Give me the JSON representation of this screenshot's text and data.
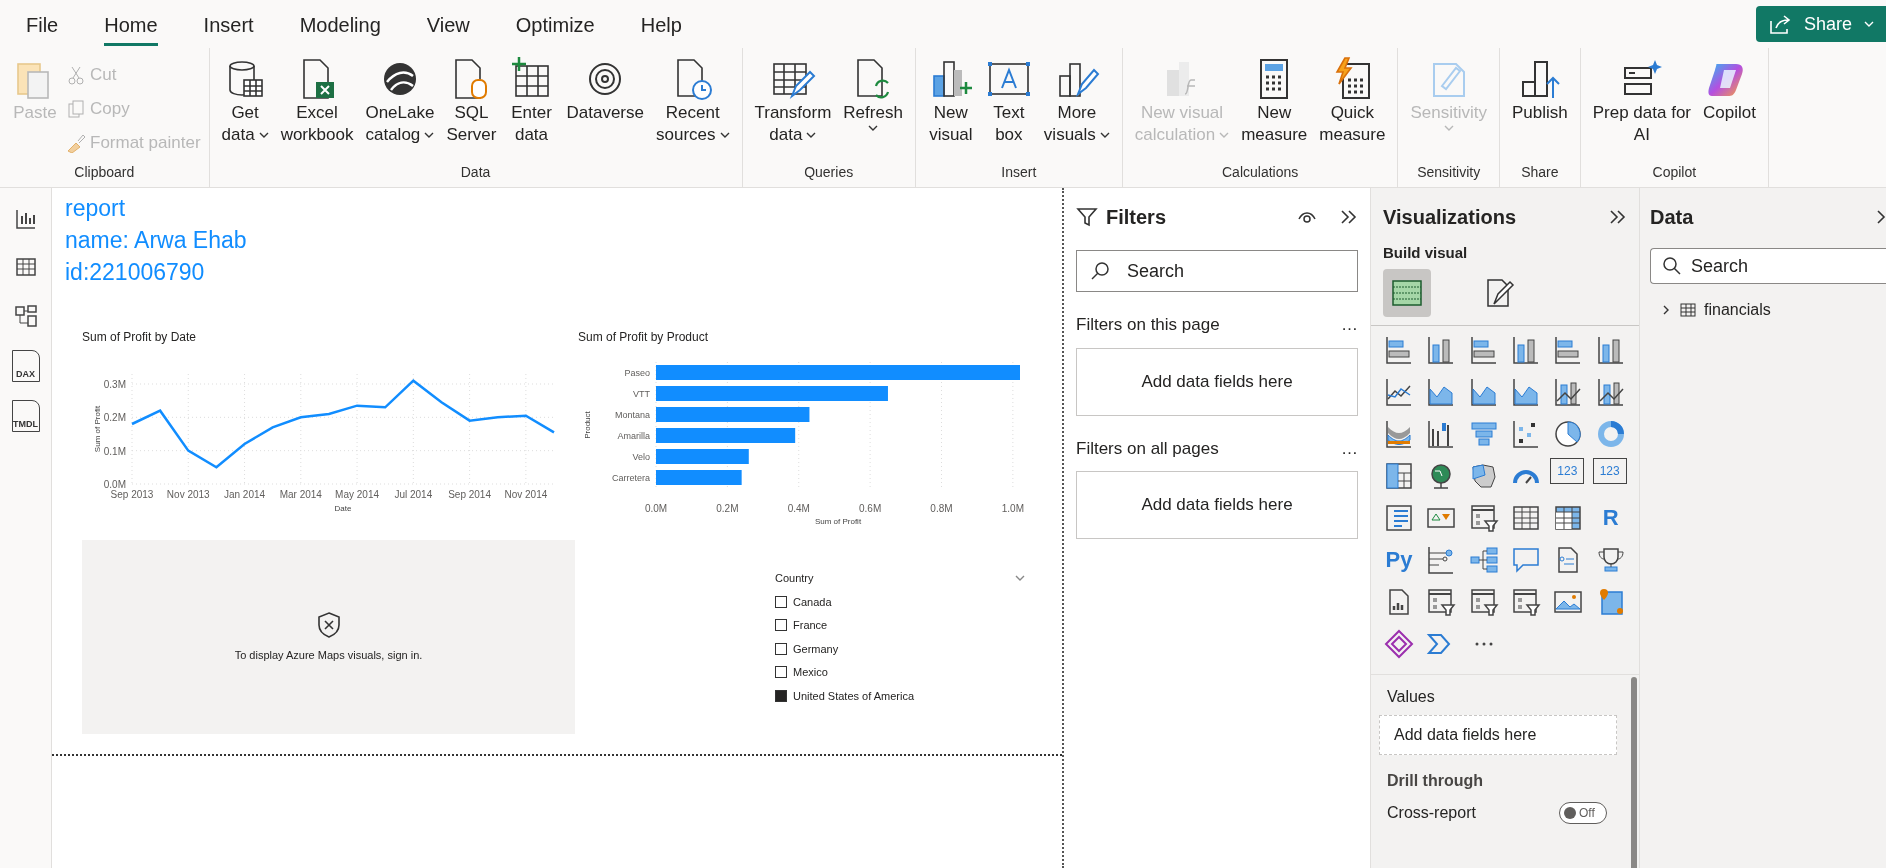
{
  "menu": {
    "tabs": [
      {
        "label": "File",
        "selected": false
      },
      {
        "label": "Home",
        "selected": true
      },
      {
        "label": "Insert",
        "selected": false
      },
      {
        "label": "Modeling",
        "selected": false
      },
      {
        "label": "View",
        "selected": false
      },
      {
        "label": "Optimize",
        "selected": false
      },
      {
        "label": "Help",
        "selected": false
      }
    ],
    "share_button": "Share"
  },
  "ribbon": [
    {
      "label": "Clipboard",
      "buttons": [
        {
          "kind": "paste",
          "lines": [
            "Paste"
          ],
          "dropdown": false,
          "disabled": true
        }
      ],
      "small_buttons": [
        {
          "kind": "cut",
          "label": "Cut",
          "disabled": true
        },
        {
          "kind": "copy",
          "label": "Copy",
          "disabled": true
        },
        {
          "kind": "brush",
          "label": "Format painter",
          "disabled": true
        }
      ]
    },
    {
      "label": "Data",
      "buttons": [
        {
          "kind": "database",
          "lines": [
            "Get",
            "data"
          ],
          "dropdown": true,
          "disabled": false
        },
        {
          "kind": "excel",
          "lines": [
            "Excel",
            "workbook"
          ],
          "dropdown": false,
          "disabled": false
        },
        {
          "kind": "onelake",
          "lines": [
            "OneLake",
            "catalog"
          ],
          "dropdown": true,
          "disabled": false
        },
        {
          "kind": "sql",
          "lines": [
            "SQL",
            "Server"
          ],
          "dropdown": false,
          "disabled": false
        },
        {
          "kind": "enter",
          "lines": [
            "Enter",
            "data"
          ],
          "dropdown": false,
          "disabled": false
        },
        {
          "kind": "dataverse",
          "lines": [
            "Dataverse"
          ],
          "dropdown": false,
          "disabled": false
        },
        {
          "kind": "recent",
          "lines": [
            "Recent",
            "sources"
          ],
          "dropdown": true,
          "disabled": false
        }
      ]
    },
    {
      "label": "Queries",
      "buttons": [
        {
          "kind": "transform",
          "lines": [
            "Transform",
            "data"
          ],
          "dropdown": true,
          "disabled": false
        },
        {
          "kind": "refresh",
          "lines": [
            "Refresh"
          ],
          "dropdown": true,
          "disabled": false
        }
      ]
    },
    {
      "label": "Insert",
      "buttons": [
        {
          "kind": "newvisual",
          "lines": [
            "New",
            "visual"
          ],
          "dropdown": false,
          "disabled": false
        },
        {
          "kind": "textbox",
          "lines": [
            "Text",
            "box"
          ],
          "dropdown": false,
          "disabled": false
        },
        {
          "kind": "morevisuals",
          "lines": [
            "More",
            "visuals"
          ],
          "dropdown": true,
          "disabled": false
        }
      ]
    },
    {
      "label": "Calculations",
      "buttons": [
        {
          "kind": "visualcalc",
          "lines": [
            "New visual",
            "calculation"
          ],
          "dropdown": true,
          "disabled": true
        },
        {
          "kind": "calculator",
          "lines": [
            "New",
            "measure"
          ],
          "dropdown": false,
          "disabled": false
        },
        {
          "kind": "quick",
          "lines": [
            "Quick",
            "measure"
          ],
          "dropdown": false,
          "disabled": false
        }
      ]
    },
    {
      "label": "Sensitivity",
      "buttons": [
        {
          "kind": "sensitivity",
          "lines": [
            "Sensitivity"
          ],
          "dropdown": true,
          "disabled": true
        }
      ]
    },
    {
      "label": "Share",
      "buttons": [
        {
          "kind": "publish",
          "lines": [
            "Publish"
          ],
          "dropdown": false,
          "disabled": false
        }
      ]
    },
    {
      "label": "Copilot",
      "buttons": [
        {
          "kind": "prep",
          "lines": [
            "Prep data for",
            "AI"
          ],
          "dropdown": false,
          "disabled": false
        },
        {
          "kind": "copilot",
          "lines": [
            "Copilot"
          ],
          "dropdown": false,
          "disabled": false
        }
      ]
    }
  ],
  "nav": [
    {
      "kind": "report"
    },
    {
      "kind": "table"
    },
    {
      "kind": "model"
    },
    {
      "kind": "doc",
      "text": "DAX"
    },
    {
      "kind": "doc",
      "text": "TMDL"
    }
  ],
  "canvas": {
    "header_lines": [
      "report",
      "name: Arwa Ehab",
      "id:221006790"
    ],
    "line_chart": {
      "chart_data": {
        "type": "line",
        "title": "Sum of Profit by Date",
        "xlabel": "Date",
        "ylabel": "Sum of Profit",
        "grid": true,
        "categories": [
          "Sep 2013",
          null,
          "Nov 2013",
          null,
          "Jan 2014",
          null,
          "Mar 2014",
          null,
          "May 2014",
          null,
          "Jul 2014",
          null,
          "Sep 2014",
          null,
          "Nov 2014",
          null
        ],
        "series": [
          {
            "color": "#118dff",
            "values": [
              0.18,
              0.22,
              0.1,
              0.05,
              0.12,
              0.17,
              0.2,
              0.21,
              0.235,
              0.23,
              0.31,
              0.245,
              0.19,
              0.2,
              0.205,
              0.155
            ]
          }
        ],
        "ylim": [
          0,
          0.33
        ],
        "yticks": [
          {
            "value": 0,
            "label": "0.0M"
          },
          {
            "value": 0.1,
            "label": "0.1M"
          },
          {
            "value": 0.2,
            "label": "0.2M"
          },
          {
            "value": 0.3,
            "label": "0.3M"
          }
        ]
      }
    },
    "bar_chart": {
      "chart_data": {
        "type": "bar",
        "orientation": "horizontal",
        "title": "Sum of Profit by Product",
        "xlabel": "Sum of Profit",
        "ylabel": "Product",
        "categories": [
          "Paseo",
          "VTT",
          "Montana",
          "Amarilla",
          "Velo",
          "Carretera"
        ],
        "grid": true,
        "series": [
          {
            "color": "#118dff",
            "values": [
              1.02,
              0.65,
              0.43,
              0.39,
              0.26,
              0.24
            ]
          }
        ],
        "xlim": [
          0,
          1.02
        ],
        "xticks": [
          {
            "value": 0,
            "label": "0.0M"
          },
          {
            "value": 0.2,
            "label": "0.2M"
          },
          {
            "value": 0.4,
            "label": "0.4M"
          },
          {
            "value": 0.6,
            "label": "0.6M"
          },
          {
            "value": 0.8,
            "label": "0.8M"
          },
          {
            "value": 1,
            "label": "1.0M"
          }
        ]
      }
    },
    "map_message": "To display Azure Maps visuals, sign in.",
    "slicer": {
      "title": "Country",
      "items": [
        {
          "label": "Canada",
          "checked": false
        },
        {
          "label": "France",
          "checked": false
        },
        {
          "label": "Germany",
          "checked": false
        },
        {
          "label": "Mexico",
          "checked": false
        },
        {
          "label": "United States of America",
          "checked": true
        }
      ]
    }
  },
  "filters": {
    "title": "Filters",
    "search": {
      "placeholder": "Search"
    },
    "sections": [
      {
        "title": "Filters on this page",
        "more": "…",
        "drop": "Add data fields here"
      },
      {
        "title": "Filters on all pages",
        "more": "…",
        "drop": "Add data fields here"
      }
    ]
  },
  "visualizations": {
    "title": "Visualizations",
    "subtitle": "Build visual",
    "tabs": [
      {
        "kind": "build",
        "selected": true
      },
      {
        "kind": "format",
        "selected": false
      }
    ],
    "gallery": [
      {
        "kind": "bar_h"
      },
      {
        "kind": "bar_v"
      },
      {
        "kind": "bar_h"
      },
      {
        "kind": "bar_v"
      },
      {
        "kind": "bar_h"
      },
      {
        "kind": "bar_v"
      },
      {
        "kind": "line"
      },
      {
        "kind": "area"
      },
      {
        "kind": "area"
      },
      {
        "kind": "area"
      },
      {
        "kind": "combo"
      },
      {
        "kind": "combo"
      },
      {
        "kind": "ribbon"
      },
      {
        "kind": "waterfall"
      },
      {
        "kind": "funnel"
      },
      {
        "kind": "scatter"
      },
      {
        "kind": "pie"
      },
      {
        "kind": "donut"
      },
      {
        "kind": "treemap"
      },
      {
        "kind": "globe"
      },
      {
        "kind": "map"
      },
      {
        "kind": "gauge"
      },
      {
        "kind": "card",
        "text": "123"
      },
      {
        "kind": "card",
        "text": "123"
      },
      {
        "kind": "list"
      },
      {
        "kind": "kpi"
      },
      {
        "kind": "slicer"
      },
      {
        "kind": "table"
      },
      {
        "kind": "matrix"
      },
      {
        "kind": "script",
        "text": "R"
      },
      {
        "kind": "script",
        "text": "Py"
      },
      {
        "kind": "influencers"
      },
      {
        "kind": "tree"
      },
      {
        "kind": "chat"
      },
      {
        "kind": "document"
      },
      {
        "kind": "trophy"
      },
      {
        "kind": "report"
      },
      {
        "kind": "slicer"
      },
      {
        "kind": "slicer"
      },
      {
        "kind": "slicer"
      },
      {
        "kind": "image"
      },
      {
        "kind": "pin_map"
      },
      {
        "kind": "diamond"
      },
      {
        "kind": "chevrons"
      },
      {
        "kind": "more"
      }
    ],
    "values_title": "Values",
    "values_drop": "Add data fields here",
    "drill_title": "Drill through",
    "toggle": {
      "label": "Cross-report",
      "on": false,
      "text": "Off"
    }
  },
  "data": {
    "title": "Data",
    "search": {
      "placeholder": "Search"
    },
    "tree": [
      {
        "label": "financials",
        "expanded": false
      }
    ]
  }
}
